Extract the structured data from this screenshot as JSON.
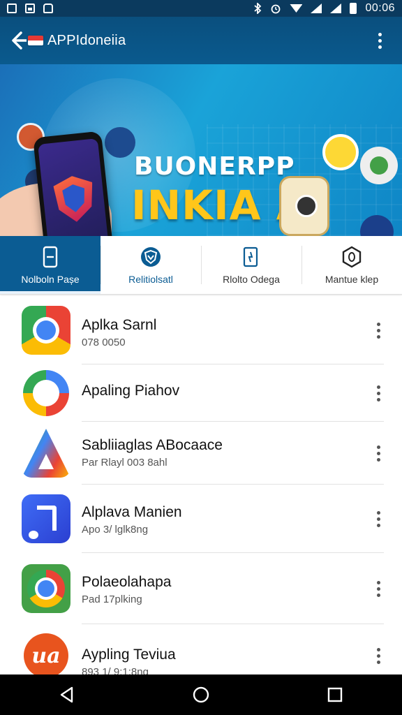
{
  "status_bar": {
    "time": "00:06",
    "icons_left": [
      "notification-icon",
      "image-icon",
      "car-icon"
    ],
    "icons_right": [
      "bluetooth-icon",
      "alarm-icon",
      "wifi-icon",
      "signal-icon",
      "signal-icon",
      "battery-icon"
    ]
  },
  "appbar": {
    "title": "APPIdoneiia",
    "back_icon": "back-arrow-icon",
    "menu_icon": "more-vert-icon"
  },
  "banner": {
    "line1": "BUONERPP",
    "line2": "INKIA A",
    "slide_count": 3,
    "active_slide": 2
  },
  "tabs": [
    {
      "label": "Nolboln Pașe",
      "icon": "phone-icon",
      "active": true
    },
    {
      "label": "Relitiolsatl",
      "icon": "shield-icon",
      "active": false
    },
    {
      "label": "Rlolto Odega",
      "icon": "phone-refresh-icon",
      "active": false
    },
    {
      "label": "Mantue klep",
      "icon": "hexagon-icon",
      "active": false
    }
  ],
  "apps": [
    {
      "name": "Aplka Sarnl",
      "subtitle": "078 0050",
      "icon": "chrome-icon"
    },
    {
      "name": "Apaling Piahov",
      "subtitle": "",
      "icon": "pay-icon"
    },
    {
      "name": "Sabliiaglas ABocaace",
      "subtitle": "Par Rlayl 003 8ahl",
      "icon": "triangle-app-icon"
    },
    {
      "name": "Alplava Manien",
      "subtitle": "Apo 3/ lglk8ng",
      "icon": "music-icon"
    },
    {
      "name": "Polaeolahapa",
      "subtitle": "Pad 17plking",
      "icon": "chrome-icon"
    },
    {
      "name": "Aypling Teviua",
      "subtitle": "893 1/ 9:1:8ng",
      "icon": "ua-icon"
    }
  ],
  "navbar": {
    "back": "back-triangle-icon",
    "home": "home-circle-icon",
    "recents": "recents-square-icon"
  }
}
